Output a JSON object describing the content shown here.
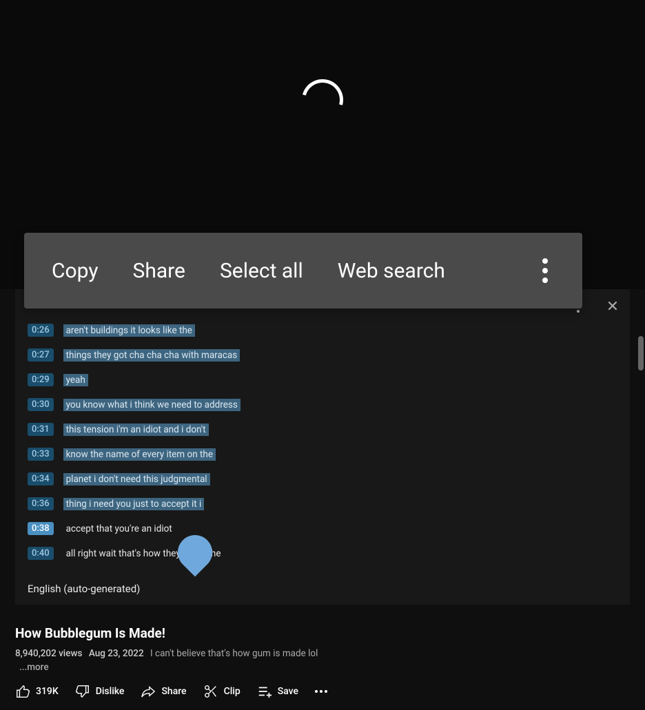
{
  "contextMenu": {
    "copy": "Copy",
    "share": "Share",
    "selectAll": "Select all",
    "webSearch": "Web search"
  },
  "transcript": {
    "rows": [
      {
        "time": "0:26",
        "text": "aren't buildings it looks like the",
        "highlighted": true
      },
      {
        "time": "0:27",
        "text": "things they got cha cha cha with maracas",
        "highlighted": true
      },
      {
        "time": "0:29",
        "text": "yeah",
        "highlighted": true
      },
      {
        "time": "0:30",
        "text": "you know what i think we need to address",
        "highlighted": true
      },
      {
        "time": "0:31",
        "text": "this tension i'm an idiot and i don't",
        "highlighted": true
      },
      {
        "time": "0:33",
        "text": "know the name of every item on the",
        "highlighted": true
      },
      {
        "time": "0:34",
        "text": "planet i don't need this judgmental",
        "highlighted": true
      },
      {
        "time": "0:36",
        "text": "thing i need you just to accept it i",
        "highlighted": true
      },
      {
        "time": "0:38",
        "text": "accept that you're an idiot",
        "highlighted": false,
        "active": true
      },
      {
        "time": "0:40",
        "text": "all right wait that's how they make the",
        "highlighted": false
      }
    ],
    "language": "English (auto-generated)"
  },
  "video": {
    "title": "How Bubblegum Is Made!",
    "views": "8,940,202 views",
    "date": "Aug 23, 2022",
    "description": "I can't believe that's how gum is made lol",
    "moreLabel": "...more"
  },
  "actions": {
    "likes": "319K",
    "dislike": "Dislike",
    "share": "Share",
    "clip": "Clip",
    "save": "Save"
  }
}
